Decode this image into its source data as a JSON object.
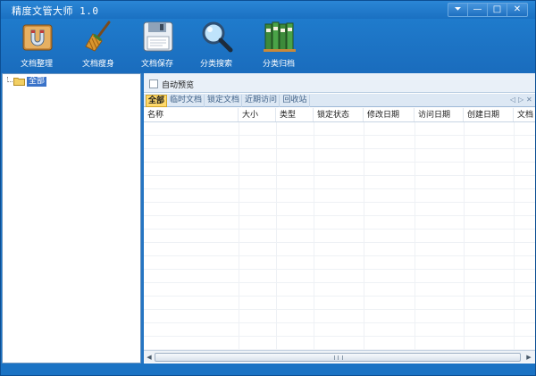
{
  "window": {
    "title": "精度文管大师 1.0",
    "controls": {
      "menu": "⏷",
      "minimize": "—",
      "maximize": "□",
      "close": "✕"
    }
  },
  "toolbar": {
    "items": [
      {
        "label": "文档整理",
        "icon": "magnet-box-icon"
      },
      {
        "label": "文档瘦身",
        "icon": "broom-icon"
      },
      {
        "label": "文档保存",
        "icon": "floppy-disk-icon"
      },
      {
        "label": "分类搜索",
        "icon": "magnifier-icon"
      },
      {
        "label": "分类归档",
        "icon": "binders-icon"
      }
    ]
  },
  "tree": {
    "root_label": "全部"
  },
  "preview": {
    "auto_preview_label": "自动预览",
    "checked": false
  },
  "tabs": [
    {
      "label": "全部",
      "active": true
    },
    {
      "label": "临时文档",
      "active": false
    },
    {
      "label": "锁定文档",
      "active": false
    },
    {
      "label": "近期访问",
      "active": false
    },
    {
      "label": "回收站",
      "active": false
    }
  ],
  "tab_controls": {
    "prev": "◁",
    "next": "▷",
    "close": "✕"
  },
  "columns": [
    "名称",
    "大小",
    "类型",
    "锁定状态",
    "修改日期",
    "访问日期",
    "创建日期",
    "文档"
  ],
  "rows": [],
  "scrollbar": {
    "left": "◀",
    "right": "▶"
  },
  "colors": {
    "frame": "#1b73c4",
    "active_tab": "#ffd96a",
    "tree_selected": "#3a73c9"
  }
}
